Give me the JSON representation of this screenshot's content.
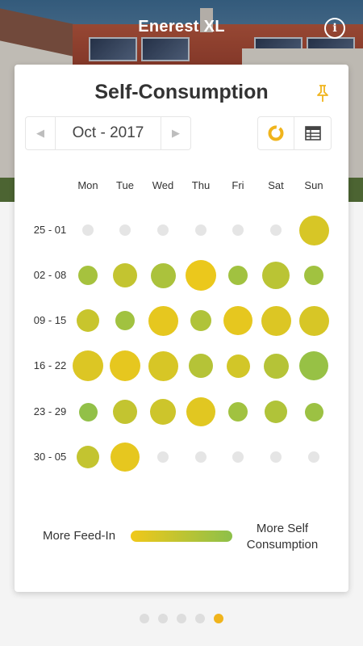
{
  "header": {
    "app_title": "Enerest XL",
    "info_label": "i"
  },
  "card": {
    "title": "Self-Consumption",
    "period": "Oct - 2017",
    "prev_label": "◀",
    "next_label": "▶"
  },
  "calendar": {
    "days": [
      "Mon",
      "Tue",
      "Wed",
      "Thu",
      "Fri",
      "Sat",
      "Sun"
    ],
    "weeks": [
      {
        "label": "25 - 01",
        "cells": [
          {
            "size": 0,
            "ratio": null
          },
          {
            "size": 0,
            "ratio": null
          },
          {
            "size": 0,
            "ratio": null
          },
          {
            "size": 0,
            "ratio": null
          },
          {
            "size": 0,
            "ratio": null
          },
          {
            "size": 0,
            "ratio": null
          },
          {
            "size": 0.8,
            "ratio": 0.25
          }
        ]
      },
      {
        "label": "02 - 08",
        "cells": [
          {
            "size": 0.25,
            "ratio": 0.75
          },
          {
            "size": 0.5,
            "ratio": 0.45
          },
          {
            "size": 0.55,
            "ratio": 0.7
          },
          {
            "size": 0.85,
            "ratio": 0.05
          },
          {
            "size": 0.25,
            "ratio": 0.8
          },
          {
            "size": 0.65,
            "ratio": 0.55
          },
          {
            "size": 0.25,
            "ratio": 0.8
          }
        ]
      },
      {
        "label": "09 - 15",
        "cells": [
          {
            "size": 0.4,
            "ratio": 0.4
          },
          {
            "size": 0.25,
            "ratio": 0.8
          },
          {
            "size": 0.8,
            "ratio": 0.1
          },
          {
            "size": 0.35,
            "ratio": 0.65
          },
          {
            "size": 0.75,
            "ratio": 0.1
          },
          {
            "size": 0.8,
            "ratio": 0.2
          },
          {
            "size": 0.8,
            "ratio": 0.25
          }
        ]
      },
      {
        "label": "16 - 22",
        "cells": [
          {
            "size": 0.85,
            "ratio": 0.2
          },
          {
            "size": 0.85,
            "ratio": 0.1
          },
          {
            "size": 0.8,
            "ratio": 0.25
          },
          {
            "size": 0.5,
            "ratio": 0.6
          },
          {
            "size": 0.45,
            "ratio": 0.3
          },
          {
            "size": 0.55,
            "ratio": 0.6
          },
          {
            "size": 0.75,
            "ratio": 0.9
          }
        ]
      },
      {
        "label": "23 - 29",
        "cells": [
          {
            "size": 0.2,
            "ratio": 0.95
          },
          {
            "size": 0.5,
            "ratio": 0.45
          },
          {
            "size": 0.6,
            "ratio": 0.35
          },
          {
            "size": 0.75,
            "ratio": 0.15
          },
          {
            "size": 0.25,
            "ratio": 0.8
          },
          {
            "size": 0.4,
            "ratio": 0.65
          },
          {
            "size": 0.2,
            "ratio": 0.85
          }
        ]
      },
      {
        "label": "30 - 05",
        "cells": [
          {
            "size": 0.4,
            "ratio": 0.45
          },
          {
            "size": 0.75,
            "ratio": 0.1
          },
          {
            "size": 0,
            "ratio": null
          },
          {
            "size": 0,
            "ratio": null
          },
          {
            "size": 0,
            "ratio": null
          },
          {
            "size": 0,
            "ratio": null
          },
          {
            "size": 0,
            "ratio": null
          }
        ]
      }
    ]
  },
  "legend": {
    "left_label": "More Feed-In",
    "right_label_line1": "More Self",
    "right_label_line2": "Consumption"
  },
  "colors": {
    "feed_in": "#f0c81a",
    "self_consumption": "#8dc04a",
    "empty_day": "#e5e5e5",
    "accent": "#f0b41c"
  },
  "pager": {
    "count": 5,
    "active_index": 4
  }
}
